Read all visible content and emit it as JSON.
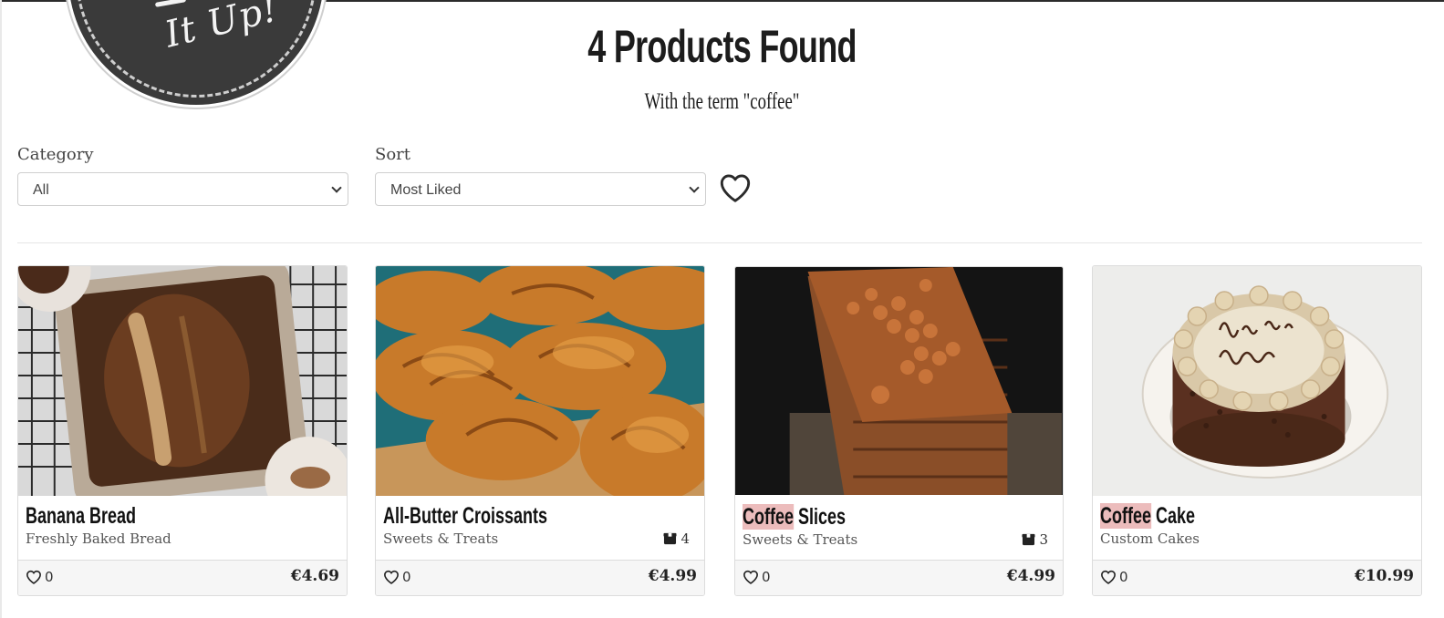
{
  "logo": {
    "text": "It Up!"
  },
  "header": {
    "title": "4 Products Found",
    "subtitle": "With the term \"coffee\""
  },
  "filters": {
    "category_label": "Category",
    "category_value": "All",
    "sort_label": "Sort",
    "sort_value": "Most Liked"
  },
  "products": [
    {
      "name": "Banana Bread",
      "highlight": "",
      "rest": "Banana Bread",
      "category": "Freshly Baked Bread",
      "stock": "",
      "likes": "0",
      "price": "€4.69"
    },
    {
      "name": "All-Butter Croissants",
      "highlight": "",
      "rest": "All-Butter Croissants",
      "category": "Sweets & Treats",
      "stock": "4",
      "likes": "0",
      "price": "€4.99"
    },
    {
      "name": "Coffee Slices",
      "highlight": "Coffee",
      "rest": " Slices",
      "category": "Sweets & Treats",
      "stock": "3",
      "likes": "0",
      "price": "€4.99"
    },
    {
      "name": "Coffee Cake",
      "highlight": "Coffee",
      "rest": " Cake",
      "category": "Custom Cakes",
      "stock": "",
      "likes": "0",
      "price": "€10.99"
    }
  ],
  "icons": {
    "heart": "heart-icon",
    "box": "box-icon",
    "chevron": "chevron-down-icon"
  },
  "colors": {
    "highlight": "#ecbcbc",
    "footer_bg": "#f6f6f6",
    "logo_bg": "#3a3a3a"
  }
}
